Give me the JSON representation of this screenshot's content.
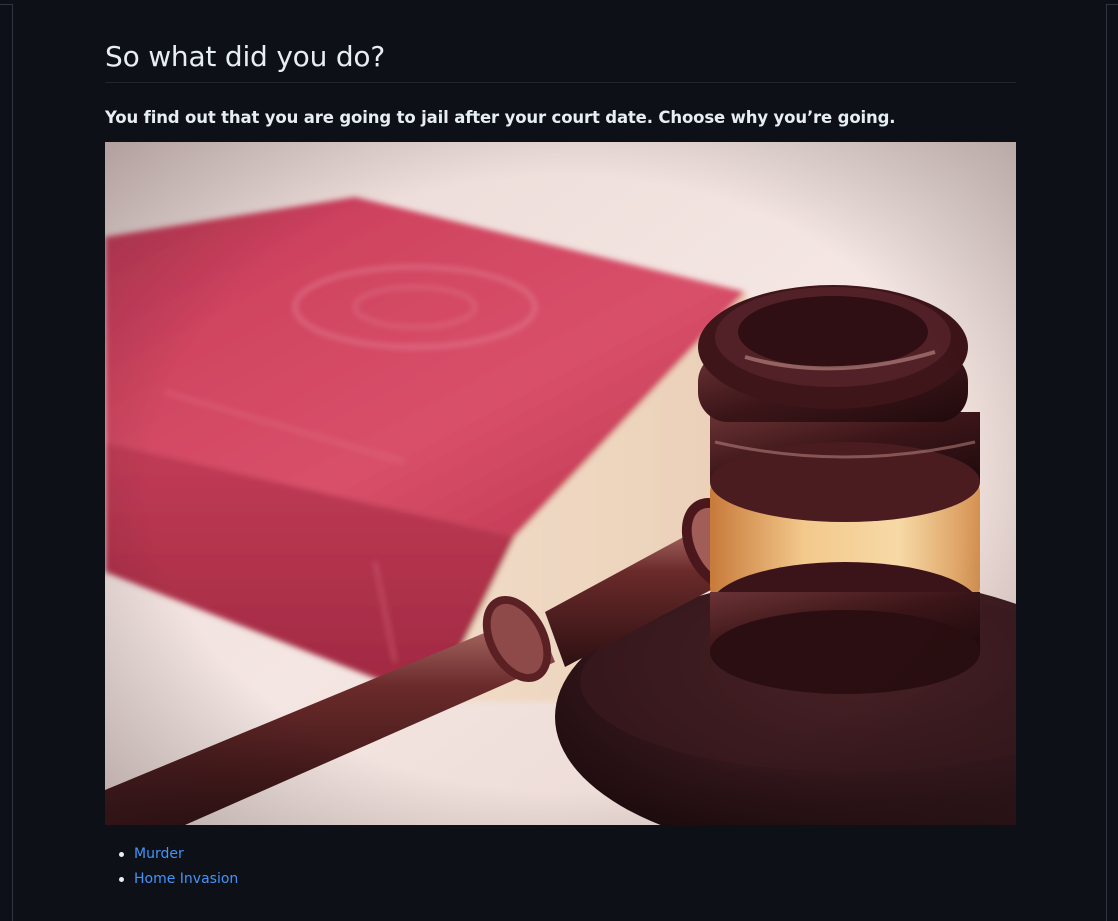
{
  "heading": "So what did you do?",
  "intro": "You find out that you are going to jail after your court date. Choose why you’re going.",
  "image": {
    "icon": "gavel-and-law-book-image"
  },
  "choices": [
    {
      "label": "Murder"
    },
    {
      "label": "Home Invasion"
    }
  ],
  "colors": {
    "background": "#0d1117",
    "text": "#e6edf3",
    "link": "#4493f8",
    "border": "#30363d"
  }
}
